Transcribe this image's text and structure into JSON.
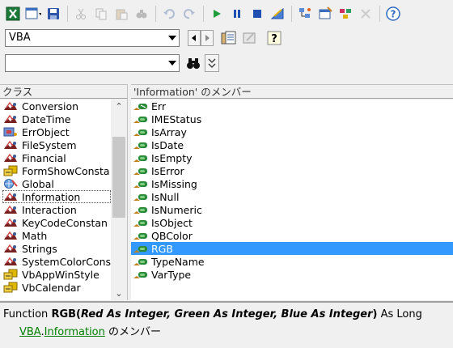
{
  "toolbar": {
    "buttons": [
      "excel-icon",
      "insert-userform-icon",
      "save-icon",
      "cut-icon",
      "copy-icon",
      "paste-icon",
      "find-icon",
      "undo-icon",
      "redo-icon",
      "run-icon",
      "break-icon",
      "reset-icon",
      "design-mode-icon",
      "project-explorer-icon",
      "properties-icon",
      "object-browser-icon",
      "toolbox-icon",
      "help-icon"
    ]
  },
  "library_combo": {
    "value": "VBA"
  },
  "search_combo": {
    "value": ""
  },
  "classes": {
    "header": "クラス",
    "items": [
      {
        "label": "Conversion",
        "icon": "module"
      },
      {
        "label": "DateTime",
        "icon": "module"
      },
      {
        "label": "ErrObject",
        "icon": "class"
      },
      {
        "label": "FileSystem",
        "icon": "module"
      },
      {
        "label": "Financial",
        "icon": "module"
      },
      {
        "label": "FormShowConsta",
        "icon": "enum"
      },
      {
        "label": "Global",
        "icon": "global"
      },
      {
        "label": "Information",
        "icon": "module",
        "selected": true
      },
      {
        "label": "Interaction",
        "icon": "module"
      },
      {
        "label": "KeyCodeConstan",
        "icon": "module"
      },
      {
        "label": "Math",
        "icon": "module"
      },
      {
        "label": "Strings",
        "icon": "module"
      },
      {
        "label": "SystemColorCons",
        "icon": "module"
      },
      {
        "label": "VbAppWinStyle",
        "icon": "enum"
      },
      {
        "label": "VbCalendar",
        "icon": "enum"
      }
    ]
  },
  "members": {
    "header": "'Information' のメンバー",
    "items": [
      {
        "label": "Err"
      },
      {
        "label": "IMEStatus"
      },
      {
        "label": "IsArray"
      },
      {
        "label": "IsDate"
      },
      {
        "label": "IsEmpty"
      },
      {
        "label": "IsError"
      },
      {
        "label": "IsMissing"
      },
      {
        "label": "IsNull"
      },
      {
        "label": "IsNumeric"
      },
      {
        "label": "IsObject"
      },
      {
        "label": "QBColor"
      },
      {
        "label": "RGB",
        "selected": true
      },
      {
        "label": "TypeName"
      },
      {
        "label": "VarType"
      }
    ]
  },
  "details": {
    "prefix": "Function ",
    "name": "RGB",
    "open_paren": "(",
    "params": "Red As Integer, Green As Integer, Blue As Integer",
    "close_paren": ")",
    "suffix": " As Long",
    "library_link": "VBA",
    "dot": ".",
    "class_link": "Information",
    "member_of": " のメンバー"
  }
}
